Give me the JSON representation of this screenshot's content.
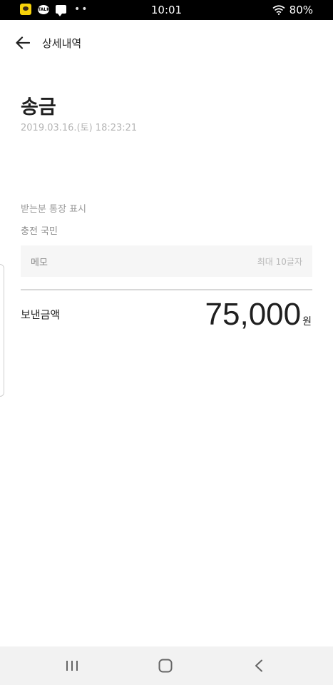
{
  "status_bar": {
    "time": "10:01",
    "battery": "80%",
    "notification_icons": [
      "kakao-icon",
      "talk-icon",
      "chat-icon",
      "more-dots-icon"
    ]
  },
  "app_bar": {
    "title": "상세내역",
    "back_icon": "arrow-left-icon"
  },
  "detail": {
    "title": "송금",
    "datetime": "2019.03.16.(토) 18:23:21",
    "receiver_label": "받는분 통장 표시",
    "receiver_value": "충전 국민",
    "memo_label": "메모",
    "memo_hint": "최대 10글자",
    "amount_label": "보낸금액",
    "amount_value": "75,000",
    "amount_unit": "원"
  },
  "nav_bar": {
    "buttons": [
      "recent-apps-icon",
      "home-icon",
      "back-icon"
    ]
  },
  "colors": {
    "status_bar_bg": "#000000",
    "page_bg": "#ffffff",
    "memo_bg": "#f6f6f6",
    "nav_bar_bg": "#f2f2f2",
    "muted_text": "#b5b5b5"
  }
}
